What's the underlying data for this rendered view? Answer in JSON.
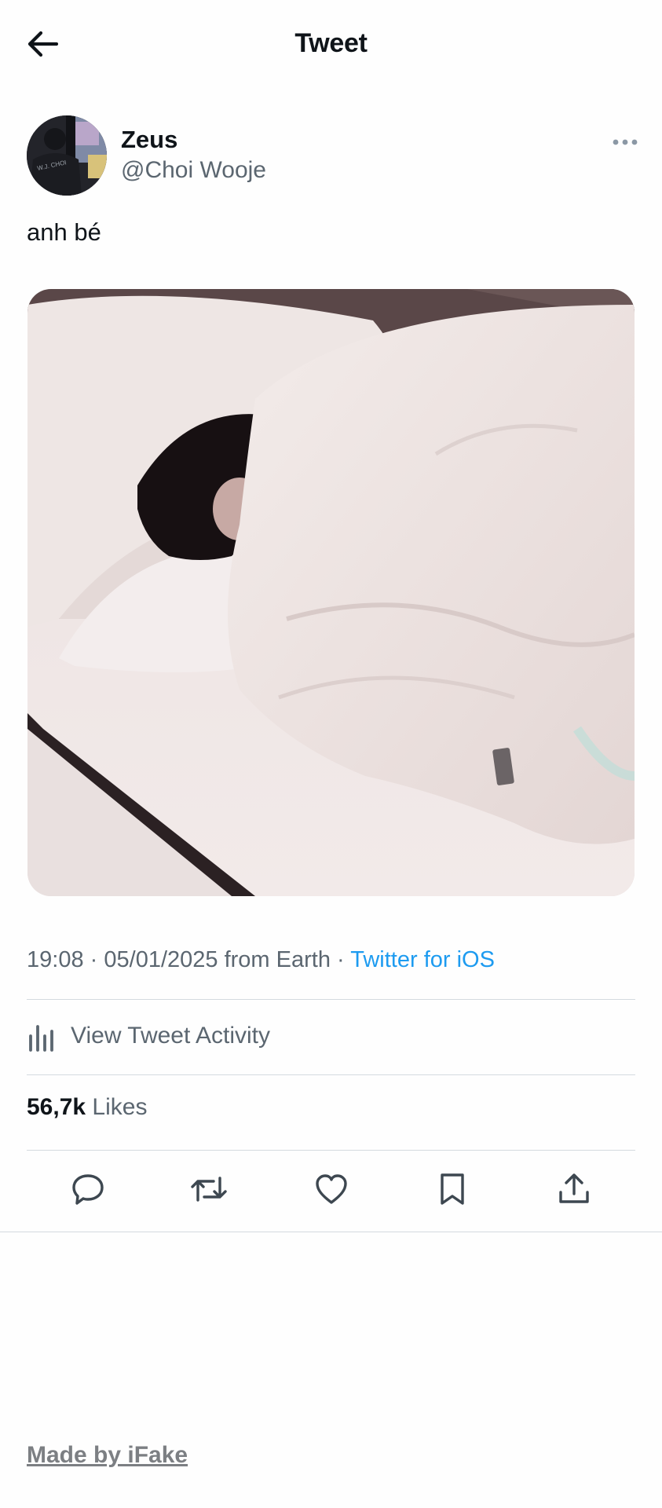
{
  "header": {
    "title": "Tweet",
    "back_icon": "arrow-left-icon"
  },
  "author": {
    "display_name": "Zeus",
    "handle": "@Choi Wooje",
    "avatar_shirt_text": "W.J. CHOI"
  },
  "tweet": {
    "text": "anh bé",
    "time": "19:08",
    "date": "05/01/2025",
    "location": "from Earth",
    "separator": "·",
    "source": "Twitter for iOS",
    "media_description": "person sleeping under white blanket"
  },
  "activity": {
    "label": "View Tweet Activity",
    "icon": "bar-chart-icon"
  },
  "likes": {
    "count": "56,7k",
    "label": "Likes"
  },
  "actions": [
    {
      "name": "reply",
      "icon": "reply-icon"
    },
    {
      "name": "retweet",
      "icon": "retweet-icon"
    },
    {
      "name": "like",
      "icon": "heart-icon"
    },
    {
      "name": "bookmark",
      "icon": "bookmark-icon"
    },
    {
      "name": "share",
      "icon": "share-icon"
    }
  ],
  "footer": {
    "link_text": "Made by iFake"
  },
  "colors": {
    "link_blue": "#1d9bf0",
    "secondary_text": "#5b6670",
    "primary_text": "#0f1419",
    "divider": "#d4dadf",
    "footer_text": "#7c7f83"
  }
}
